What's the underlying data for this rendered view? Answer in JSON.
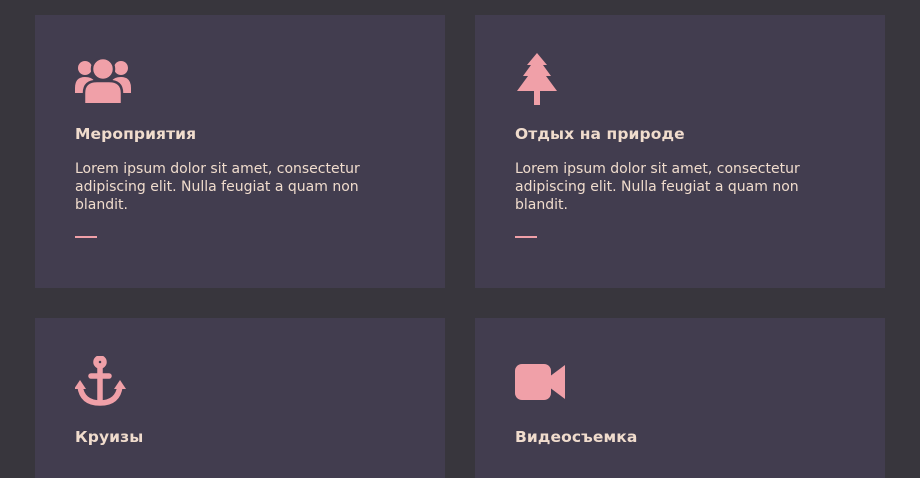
{
  "colors": {
    "page_background": "#38363d",
    "card_background": "#423d4f",
    "accent": "#f0a0a8",
    "text": "#f0dccd"
  },
  "cards": [
    {
      "icon": "users-icon",
      "title": "Мероприятия",
      "text": "Lorem ipsum dolor sit amet, consectetur adipiscing elit. Nulla feugiat a quam non blandit."
    },
    {
      "icon": "tree-icon",
      "title": "Отдых на природе",
      "text": "Lorem ipsum dolor sit amet, consectetur adipiscing elit. Nulla feugiat a quam non blandit."
    },
    {
      "icon": "anchor-icon",
      "title": "Круизы"
    },
    {
      "icon": "video-camera-icon",
      "title": "Видеосъемка"
    }
  ]
}
